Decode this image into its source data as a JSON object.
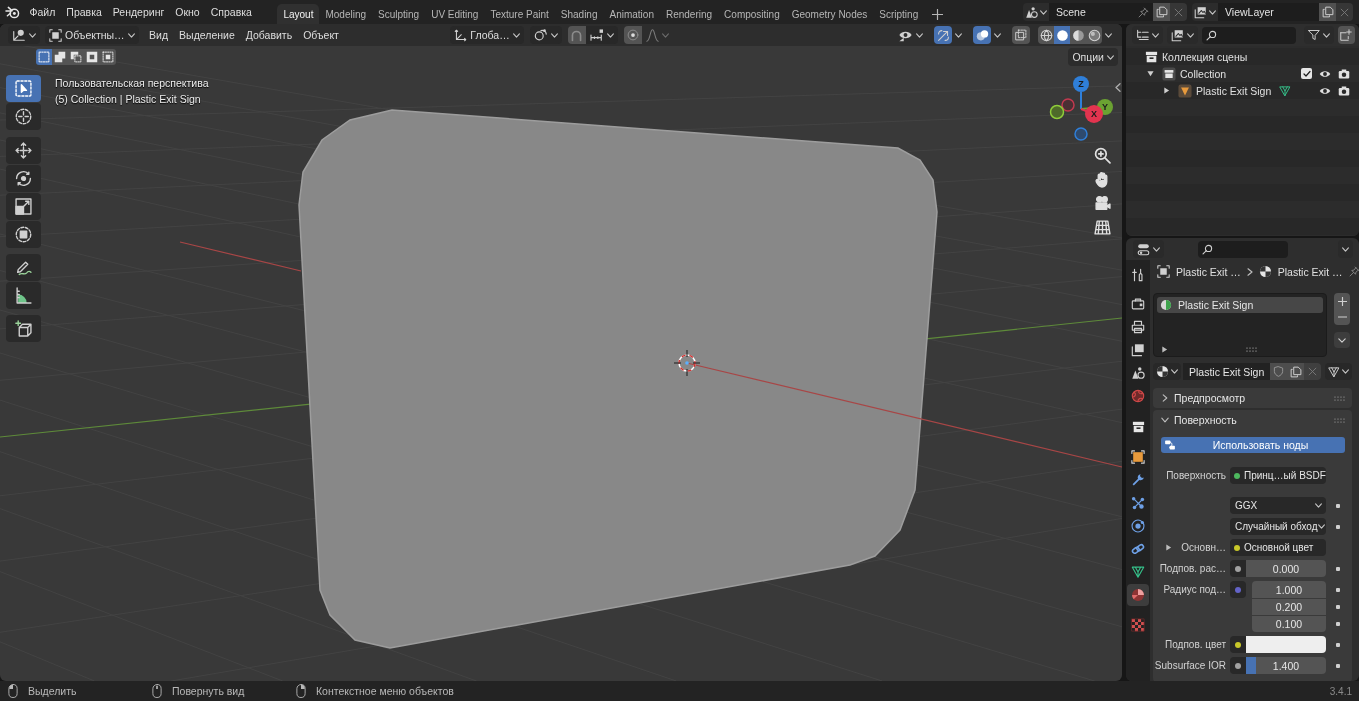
{
  "top_bar": {
    "menus": [
      "Файл",
      "Правка",
      "Рендеринг",
      "Окно",
      "Справка"
    ],
    "workspaces": [
      {
        "label": "Layout",
        "selected": true
      },
      {
        "label": "Modeling",
        "selected": false
      },
      {
        "label": "Sculpting",
        "selected": false
      },
      {
        "label": "UV Editing",
        "selected": false
      },
      {
        "label": "Texture Paint",
        "selected": false
      },
      {
        "label": "Shading",
        "selected": false
      },
      {
        "label": "Animation",
        "selected": false
      },
      {
        "label": "Rendering",
        "selected": false
      },
      {
        "label": "Compositing",
        "selected": false
      },
      {
        "label": "Geometry Nodes",
        "selected": false
      },
      {
        "label": "Scripting",
        "selected": false
      }
    ],
    "scene": "Scene",
    "view_layer": "ViewLayer"
  },
  "viewport": {
    "mode": "Объектны…",
    "menus": [
      "Вид",
      "Выделение",
      "Добавить",
      "Объект"
    ],
    "orientation": "Глоба…",
    "gizmos_on": true,
    "overlays_on": true,
    "xray_on": false,
    "shading": [
      {
        "kind": "wireframe",
        "selected": false
      },
      {
        "kind": "solid",
        "selected": true
      },
      {
        "kind": "material",
        "selected": false
      },
      {
        "kind": "rendered",
        "selected": false
      }
    ],
    "selection_modes": [
      {
        "kind": "set",
        "selected": true
      },
      {
        "kind": "extend",
        "selected": false
      },
      {
        "kind": "subtract",
        "selected": false
      },
      {
        "kind": "invert",
        "selected": false
      },
      {
        "kind": "intersect",
        "selected": false
      }
    ],
    "options": "Опции",
    "info": [
      "Пользовательская перспектива",
      "(5) Collection | Plastic Exit Sign"
    ],
    "tools": [
      {
        "kind": "select",
        "selected": true
      },
      {
        "kind": "cursor",
        "selected": false
      },
      {
        "kind": "move",
        "selected": false
      },
      {
        "kind": "rotate",
        "selected": false
      },
      {
        "kind": "scale",
        "selected": false
      },
      {
        "kind": "transform",
        "selected": false
      },
      {
        "kind": "annotate",
        "selected": false
      },
      {
        "kind": "measure",
        "selected": false
      },
      {
        "kind": "add",
        "selected": false
      }
    ],
    "axes": [
      {
        "label": "Z",
        "color": "#2f7fd9"
      },
      {
        "label": "Y",
        "color": "#6ba232"
      },
      {
        "label": "X",
        "color": "#e2344f"
      }
    ]
  },
  "outliner": {
    "tree": [
      {
        "kind": "scene",
        "label": "Коллекция сцены",
        "children": [
          {
            "kind": "collection",
            "label": "Collection",
            "expanded": true,
            "checked": true,
            "children": [
              {
                "kind": "object",
                "label": "Plastic Exit Sign",
                "expanded": false
              }
            ]
          }
        ]
      }
    ]
  },
  "properties": {
    "tabs": [
      {
        "kind": "tool",
        "selected": false
      },
      {
        "kind": "render",
        "selected": false
      },
      {
        "kind": "output",
        "selected": false
      },
      {
        "kind": "view_layer",
        "selected": false
      },
      {
        "kind": "scene",
        "selected": false
      },
      {
        "kind": "world",
        "selected": false
      },
      {
        "kind": "collection",
        "selected": false
      },
      {
        "kind": "object",
        "selected": false
      },
      {
        "kind": "modifiers",
        "selected": false
      },
      {
        "kind": "particles",
        "selected": false
      },
      {
        "kind": "physics",
        "selected": false
      },
      {
        "kind": "constraints",
        "selected": false
      },
      {
        "kind": "data",
        "selected": false
      },
      {
        "kind": "material",
        "selected": true
      },
      {
        "kind": "texture",
        "selected": false
      }
    ],
    "breadcrumb": [
      "Plastic Exit …",
      "Plastic Exit …"
    ],
    "slots": [
      {
        "label": "Plastic Exit Sign",
        "selected": true
      }
    ],
    "material": "Plastic Exit Sign",
    "panels": [
      {
        "title": "Предпросмотр",
        "expanded": false
      },
      {
        "title": "Поверхность",
        "expanded": true,
        "button": "Использовать ноды",
        "rows": [
          {
            "kind": "link",
            "label": "Поверхность",
            "value": "Принц…ый BSDF",
            "color": "#4db85e"
          },
          {
            "kind": "menu",
            "value": "GGX"
          },
          {
            "kind": "menu",
            "value": "Случайный обход"
          },
          {
            "kind": "link",
            "label": "Основн…",
            "value": "Основной цвет",
            "color": "#c7c729",
            "expanded": false
          },
          {
            "kind": "number",
            "label": "Подпов. рас…",
            "values": [
              "0.000"
            ],
            "color": "#a1a1a1"
          },
          {
            "kind": "number",
            "label": "Радиус под…",
            "values": [
              "1.000",
              "0.200",
              "0.100"
            ],
            "color": "#6363c7"
          },
          {
            "kind": "color",
            "label": "Подпов. цвет",
            "color": "#c7c729"
          },
          {
            "kind": "slider",
            "label": "Subsurface IOR",
            "value": "1.400",
            "level": 0.12,
            "color": "#a1a1a1"
          }
        ]
      }
    ]
  },
  "status_bar": {
    "hints": [
      {
        "kind": "left",
        "label": "Выделить"
      },
      {
        "kind": "middle",
        "label": "Повернуть вид"
      },
      {
        "kind": "right",
        "label": "Контекстное меню объектов"
      }
    ],
    "version": "3.4.1"
  }
}
